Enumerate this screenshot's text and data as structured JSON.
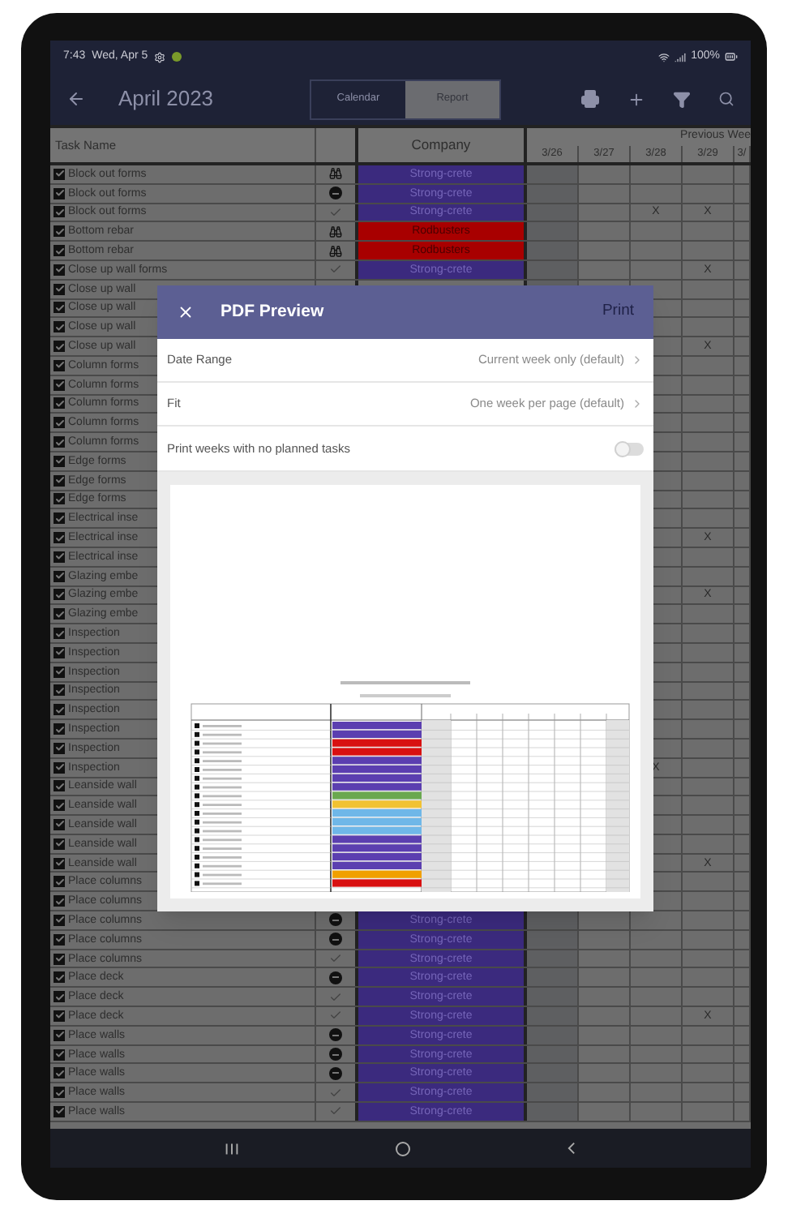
{
  "status_bar": {
    "time": "7:43",
    "date": "Wed, Apr 5",
    "battery": "100%"
  },
  "app_bar": {
    "title": "April 2023",
    "tabs": [
      {
        "label": "Calendar",
        "selected": false
      },
      {
        "label": "Report",
        "selected": true
      }
    ]
  },
  "table": {
    "columns": {
      "task": "Task Name",
      "company": "Company",
      "group": "Previous Wee",
      "days": [
        "3/26",
        "3/27",
        "3/28",
        "3/29",
        "3/"
      ]
    },
    "rows": [
      {
        "task": "Block out forms",
        "checked": true,
        "kind": "binoculars",
        "company": {
          "name": "Strong-crete",
          "color": "#3b2a7e"
        }
      },
      {
        "task": "Block out forms",
        "checked": true,
        "kind": "dot",
        "company": {
          "name": "Strong-crete",
          "color": "#3b2a7e"
        }
      },
      {
        "task": "Block out forms",
        "checked": true,
        "kind": "check",
        "company": {
          "name": "Strong-crete",
          "color": "#3b2a7e"
        },
        "days": [
          {
            "marked": false
          },
          {
            "marked": false
          },
          {
            "marked": true,
            "mark": "X"
          },
          {
            "marked": true,
            "mark": "X"
          },
          {
            "marked": false
          }
        ]
      },
      {
        "task": "Bottom rebar",
        "checked": true,
        "kind": "binoculars",
        "company": {
          "name": "Rodbusters",
          "color": "#a80000"
        }
      },
      {
        "task": "Bottom rebar",
        "checked": true,
        "kind": "binoculars",
        "company": {
          "name": "Rodbusters",
          "color": "#a80000"
        }
      },
      {
        "task": "Close up wall forms",
        "checked": true,
        "kind": "check",
        "company": {
          "name": "Strong-crete",
          "color": "#3b2a7e"
        },
        "days": [
          {
            "marked": false
          },
          {
            "marked": false
          },
          {
            "marked": false
          },
          {
            "marked": true,
            "mark": "X"
          },
          {
            "marked": false
          }
        ]
      },
      {
        "task": "Close up wall",
        "checked": true
      },
      {
        "task": "Close up wall",
        "checked": true
      },
      {
        "task": "Close up wall",
        "checked": true
      },
      {
        "task": "Close up wall",
        "checked": true,
        "days": [
          {
            "marked": false
          },
          {
            "marked": true,
            "mark": "X"
          },
          {
            "marked": false
          }
        ]
      },
      {
        "task": "Column forms",
        "checked": true
      },
      {
        "task": "Column forms",
        "checked": true
      },
      {
        "task": "Column forms",
        "checked": true
      },
      {
        "task": "Column forms",
        "checked": true
      },
      {
        "task": "Column forms",
        "checked": true
      },
      {
        "task": "Edge forms",
        "checked": true
      },
      {
        "task": "Edge forms",
        "checked": true
      },
      {
        "task": "Edge forms",
        "checked": true
      },
      {
        "task": "Electrical inse",
        "checked": true
      },
      {
        "task": "Electrical inse",
        "checked": true,
        "days": [
          {
            "marked": false
          },
          {
            "marked": true,
            "mark": "X"
          },
          {
            "marked": false
          }
        ]
      },
      {
        "task": "Electrical inse",
        "checked": true
      },
      {
        "task": "Glazing embe",
        "checked": true
      },
      {
        "task": "Glazing embe",
        "checked": true,
        "days": [
          {
            "marked": false
          },
          {
            "marked": true,
            "mark": "X"
          },
          {
            "marked": false
          }
        ]
      },
      {
        "task": "Glazing embe",
        "checked": true
      },
      {
        "task": "Inspection",
        "checked": true
      },
      {
        "task": "Inspection",
        "checked": true
      },
      {
        "task": "Inspection",
        "checked": true
      },
      {
        "task": "Inspection",
        "checked": true
      },
      {
        "task": "Inspection",
        "checked": true
      },
      {
        "task": "Inspection",
        "checked": true
      },
      {
        "task": "Inspection",
        "checked": true
      },
      {
        "task": "Inspection",
        "checked": true,
        "days": [
          {
            "marked": true,
            "mark": "X"
          },
          {
            "marked": false
          },
          {
            "marked": false
          }
        ]
      },
      {
        "task": "Leanside wall",
        "checked": true
      },
      {
        "task": "Leanside wall",
        "checked": true
      },
      {
        "task": "Leanside wall",
        "checked": true
      },
      {
        "task": "Leanside wall",
        "checked": true
      },
      {
        "task": "Leanside wall",
        "checked": true,
        "days": [
          {
            "marked": false
          },
          {
            "marked": true,
            "mark": "X"
          },
          {
            "marked": false
          }
        ]
      },
      {
        "task": "Place columns",
        "checked": true
      },
      {
        "task": "Place columns",
        "checked": true
      },
      {
        "task": "Place columns",
        "checked": true,
        "kind": "dot",
        "company": {
          "name": "Strong-crete",
          "color": "#3b2a7e"
        }
      },
      {
        "task": "Place columns",
        "checked": true,
        "kind": "dot",
        "company": {
          "name": "Strong-crete",
          "color": "#3b2a7e"
        }
      },
      {
        "task": "Place columns",
        "checked": true,
        "kind": "check",
        "company": {
          "name": "Strong-crete",
          "color": "#3b2a7e"
        }
      },
      {
        "task": "Place deck",
        "checked": true,
        "kind": "dot",
        "company": {
          "name": "Strong-crete",
          "color": "#3b2a7e"
        }
      },
      {
        "task": "Place deck",
        "checked": true,
        "kind": "check",
        "company": {
          "name": "Strong-crete",
          "color": "#3b2a7e"
        }
      },
      {
        "task": "Place deck",
        "checked": true,
        "kind": "check",
        "company": {
          "name": "Strong-crete",
          "color": "#3b2a7e"
        },
        "days": [
          {
            "marked": false
          },
          {
            "marked": false
          },
          {
            "marked": false
          },
          {
            "marked": true,
            "mark": "X"
          },
          {
            "marked": false
          }
        ]
      },
      {
        "task": "Place walls",
        "checked": true,
        "kind": "dot",
        "company": {
          "name": "Strong-crete",
          "color": "#3b2a7e"
        }
      },
      {
        "task": "Place walls",
        "checked": true,
        "kind": "dot",
        "company": {
          "name": "Strong-crete",
          "color": "#3b2a7e"
        }
      },
      {
        "task": "Place walls",
        "checked": true,
        "kind": "dot",
        "company": {
          "name": "Strong-crete",
          "color": "#3b2a7e"
        }
      },
      {
        "task": "Place walls",
        "checked": true,
        "kind": "check",
        "company": {
          "name": "Strong-crete",
          "color": "#3b2a7e"
        }
      },
      {
        "task": "Place walls",
        "checked": true,
        "kind": "check",
        "company": {
          "name": "Strong-crete",
          "color": "#3b2a7e"
        }
      }
    ]
  },
  "dialog": {
    "title": "PDF Preview",
    "action": "Print",
    "settings": [
      {
        "label": "Date Range",
        "value": "Current week only (default)"
      },
      {
        "label": "Fit",
        "value": "One week per page (default)"
      }
    ],
    "toggle": {
      "label": "Print weeks with no planned tasks",
      "on": false
    }
  }
}
